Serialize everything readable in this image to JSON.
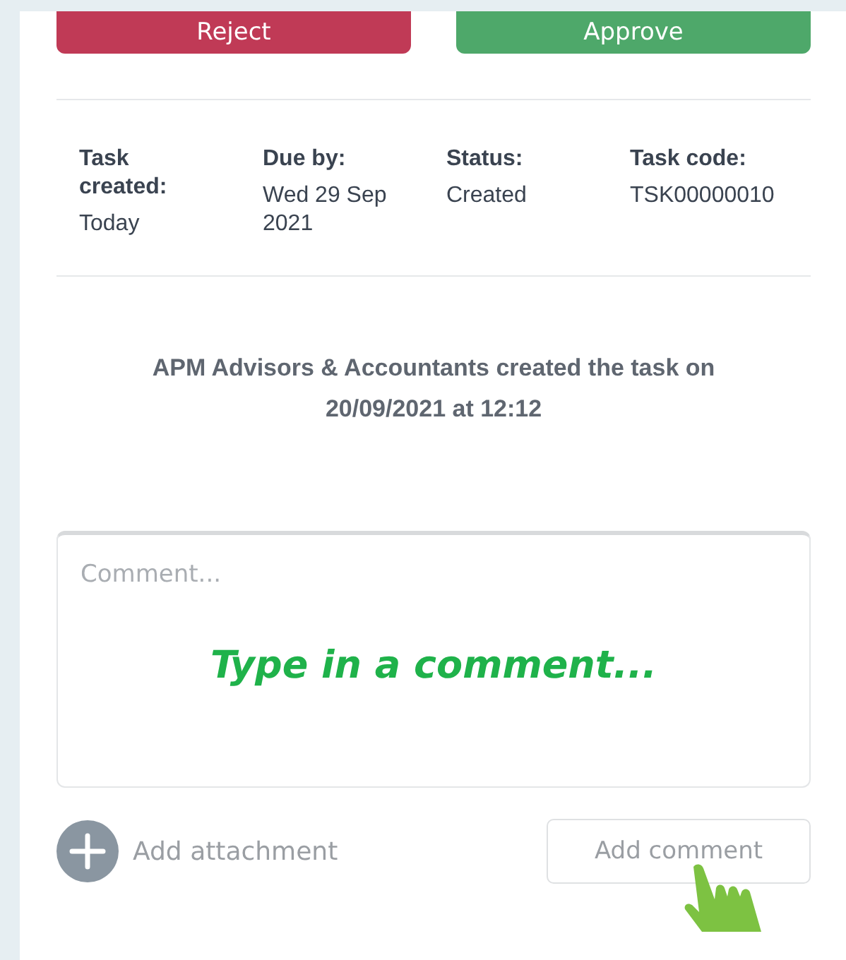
{
  "actions": [
    {
      "label": "Reject",
      "kind": "reject"
    },
    {
      "label": "Approve",
      "kind": "approve"
    }
  ],
  "details": [
    {
      "label": "Task created:",
      "value": "Today"
    },
    {
      "label": "Due by:",
      "value": "Wed 29 Sep 2021"
    },
    {
      "label": "Status:",
      "value": "Created"
    },
    {
      "label": "Task code:",
      "value": "TSK00000010"
    }
  ],
  "activity": "APM Advisors & Accountants created the task on 20/09/2021 at 12:12",
  "comment": {
    "placeholder": "Comment...",
    "hint": "Type in a comment..."
  },
  "attachment_label": "Add attachment",
  "submit_label": "Add comment"
}
